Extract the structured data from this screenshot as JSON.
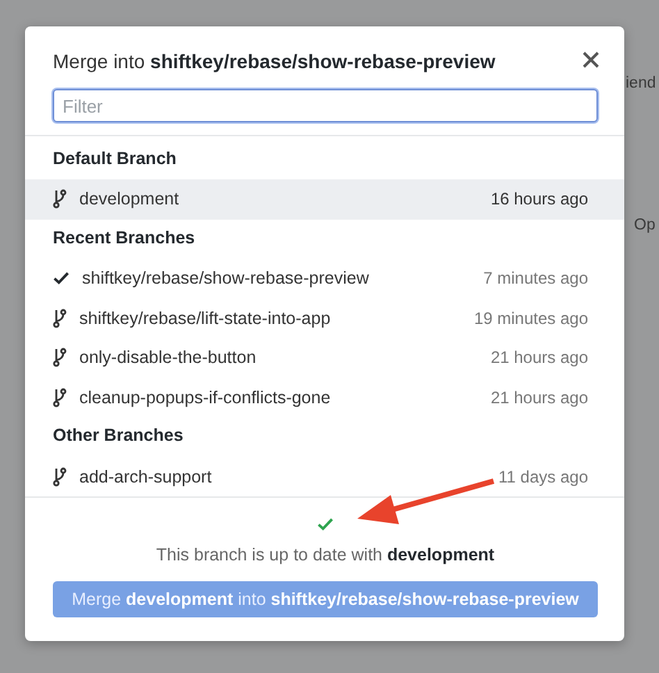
{
  "background": {
    "fragments": [
      "iend",
      "Op"
    ]
  },
  "dialog": {
    "title": "Merge into **shiftkey/rebase/show-rebase-preview**",
    "filter": {
      "placeholder": "Filter"
    },
    "groups": [
      {
        "heading": "Default Branch",
        "items": [
          {
            "name": "development",
            "time": "16 hours ago",
            "selected": true,
            "checked": false
          }
        ]
      },
      {
        "heading": "Recent Branches",
        "items": [
          {
            "name": "shiftkey/rebase/show-rebase-preview",
            "time": "7 minutes ago",
            "selected": false,
            "checked": true
          },
          {
            "name": "shiftkey/rebase/lift-state-into-app",
            "time": "19 minutes ago",
            "selected": false,
            "checked": false
          },
          {
            "name": "only-disable-the-button",
            "time": "21 hours ago",
            "selected": false,
            "checked": false
          },
          {
            "name": "cleanup-popups-if-conflicts-gone",
            "time": "21 hours ago",
            "selected": false,
            "checked": false
          }
        ]
      },
      {
        "heading": "Other Branches",
        "items": [
          {
            "name": "add-arch-support",
            "time": "11 days ago",
            "selected": false,
            "checked": false
          }
        ]
      }
    ],
    "status": "This branch is up to date with **development**",
    "merge_button": {
      "label": "Merge **development** into **shiftkey/rebase/show-rebase-preview**",
      "disabled": true
    }
  }
}
